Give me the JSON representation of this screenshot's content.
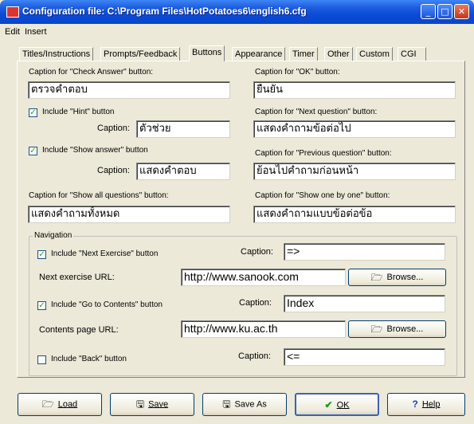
{
  "window": {
    "title": "Configuration file: C:\\Program Files\\HotPotatoes6\\english6.cfg",
    "minimize": "_",
    "maximize": "□",
    "close": "✕"
  },
  "menu": {
    "edit": "Edit",
    "insert": "Insert"
  },
  "tabs": [
    "Titles/Instructions",
    "Prompts/Feedback",
    "Buttons",
    "Appearance",
    "Timer",
    "Other",
    "Custom",
    "CGI"
  ],
  "buttons_tab": {
    "check_answer_label": "Caption for \"Check Answer\" button:",
    "check_answer_value": "ตรวจคำตอบ",
    "ok_label": "Caption for \"OK\" button:",
    "ok_value": "ยืนยัน",
    "hint_checkbox_label": "Include \"Hint\" button",
    "hint_checked": true,
    "hint_caption_label": "Caption:",
    "hint_caption_value": "ตัวช่วย",
    "next_question_label": "Caption for \"Next question\" button:",
    "next_question_value": "แสดงคำถามข้อต่อไป",
    "show_answer_checkbox_label": "Include \"Show answer\" button",
    "show_answer_checked": true,
    "show_answer_caption_label": "Caption:",
    "show_answer_caption_value": "แสดงคำตอบ",
    "previous_question_label": "Caption for \"Previous question\" button:",
    "previous_question_value": "ย้อนไปคำถามก่อนหน้า",
    "show_all_label": "Caption for \"Show all questions\" button:",
    "show_all_value": "แสดงคำถามทั้งหมด",
    "show_one_label": "Caption for \"Show one by one\" button:",
    "show_one_value": "แสดงคำถามแบบข้อต่อข้อ"
  },
  "navigation": {
    "group_label": "Navigation",
    "next_exercise_checkbox_label": "Include \"Next Exercise\" button",
    "next_exercise_checked": true,
    "next_exercise_caption_label": "Caption:",
    "next_exercise_caption_value": "=>",
    "next_exercise_url_label": "Next exercise URL:",
    "next_exercise_url_value": "http://www.sanook.com",
    "browse_label": "Browse...",
    "contents_checkbox_label": "Include \"Go to Contents\" button",
    "contents_checked": true,
    "contents_caption_label": "Caption:",
    "contents_caption_value": "Index",
    "contents_url_label": "Contents page URL:",
    "contents_url_value": "http://www.ku.ac.th",
    "back_checkbox_label": "Include \"Back\" button",
    "back_checked": false,
    "back_caption_label": "Caption:",
    "back_caption_value": "<="
  },
  "footer": {
    "load": "Load",
    "save": "Save",
    "save_as": "Save As",
    "ok": "OK",
    "help": "Help"
  },
  "icons": {
    "folder": "folder-open-icon",
    "disk": "floppy-disk-icon",
    "check": "checkmark-icon",
    "help": "question-mark-icon"
  }
}
